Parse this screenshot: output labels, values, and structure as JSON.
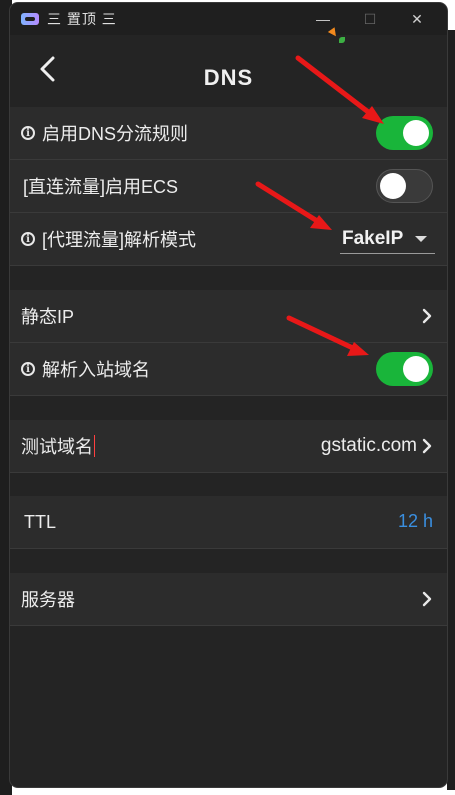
{
  "window": {
    "title": "三 置顶 三",
    "minimize_glyph": "—",
    "maximize_glyph": "☐",
    "close_glyph": "✕"
  },
  "appbar": {
    "title": "DNS"
  },
  "settings": {
    "dns_split": {
      "label": "启用DNS分流规则",
      "enabled": true
    },
    "direct_ecs": {
      "label": "[直连流量]启用ECS",
      "enabled": false
    },
    "proxy_mode": {
      "label": "[代理流量]解析模式",
      "value": "FakeIP"
    },
    "static_ip": {
      "label": "静态IP"
    },
    "resolve_inbound": {
      "label": "解析入站域名",
      "enabled": true
    },
    "test_domain": {
      "label": "测试域名",
      "value": "gstatic.com"
    },
    "ttl": {
      "label": "TTL",
      "value": "12 h"
    },
    "servers": {
      "label": "服务器"
    }
  },
  "colors": {
    "toggle_on": "#19b53a",
    "accent_blue": "#3a8fe0",
    "arrow_red": "#e81818",
    "window_bg": "#242424",
    "row_bg": "#2c2c2c"
  },
  "icons": [
    "app-icon",
    "back-arrow-icon",
    "info-icon",
    "chevron-right-icon",
    "dropdown-caret-icon",
    "carrot-icon"
  ]
}
